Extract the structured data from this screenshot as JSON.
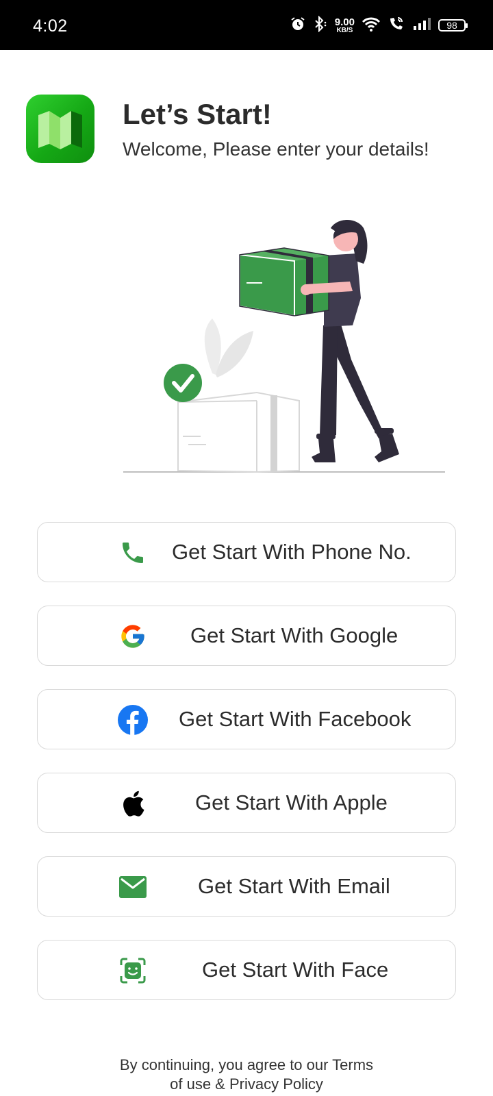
{
  "status_bar": {
    "time": "4:02",
    "net_speed_value": "9.00",
    "net_speed_unit": "KB/S",
    "battery": "98",
    "icons": [
      "alarm-icon",
      "bluetooth-icon",
      "wifi-icon",
      "wifi-calling-icon",
      "signal-icon",
      "battery-icon"
    ]
  },
  "header": {
    "title": "Let’s Start!",
    "subtitle": "Welcome, Please enter your details!"
  },
  "buttons": [
    {
      "label": "Get Start With Phone No.",
      "icon": "phone-icon",
      "icon_color": "#3a9a4a"
    },
    {
      "label": "Get Start With Google",
      "icon": "google-icon"
    },
    {
      "label": "Get Start With Facebook",
      "icon": "facebook-icon",
      "icon_color": "#1877f2"
    },
    {
      "label": "Get Start With Apple",
      "icon": "apple-icon",
      "icon_color": "#000000"
    },
    {
      "label": "Get Start With Email",
      "icon": "email-icon",
      "icon_color": "#3a9a4a"
    },
    {
      "label": "Get Start With Face",
      "icon": "face-id-icon",
      "icon_color": "#3a9a4a"
    }
  ],
  "footer": {
    "line1": "By continuing, you agree to our Terms",
    "line2": "of use & Privacy Policy"
  },
  "colors": {
    "brand_green": "#3a9a4a",
    "logo_green": "#1aa81a",
    "button_border": "#d9d9d9"
  }
}
